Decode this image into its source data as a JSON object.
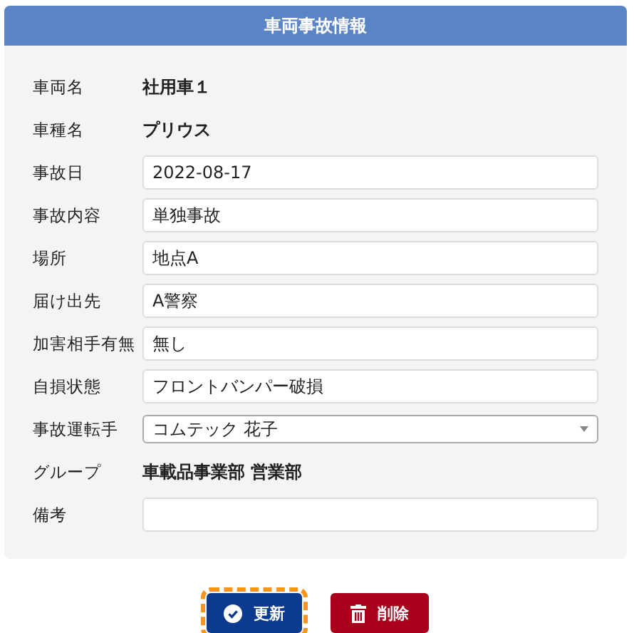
{
  "panel": {
    "title": "車両事故情報"
  },
  "fields": [
    {
      "label": "車両名",
      "kind": "text",
      "value": "社用車１"
    },
    {
      "label": "車種名",
      "kind": "text",
      "value": "プリウス"
    },
    {
      "label": "事故日",
      "kind": "input",
      "value": "2022-08-17"
    },
    {
      "label": "事故内容",
      "kind": "input",
      "value": "単独事故"
    },
    {
      "label": "場所",
      "kind": "input",
      "value": "地点A"
    },
    {
      "label": "届け出先",
      "kind": "input",
      "value": "A警察"
    },
    {
      "label": "加害相手有無",
      "kind": "input",
      "value": "無し"
    },
    {
      "label": "自損状態",
      "kind": "input",
      "value": "フロントバンパー破損"
    },
    {
      "label": "事故運転手",
      "kind": "select",
      "value": "コムテック 花子"
    },
    {
      "label": "グループ",
      "kind": "text",
      "value": "車載品事業部 営業部"
    },
    {
      "label": "備考",
      "kind": "input"
    }
  ],
  "buttons": [
    {
      "label": "更新",
      "kind": "update",
      "focused": true
    },
    {
      "label": "削除",
      "kind": "delete",
      "focused": false
    }
  ]
}
